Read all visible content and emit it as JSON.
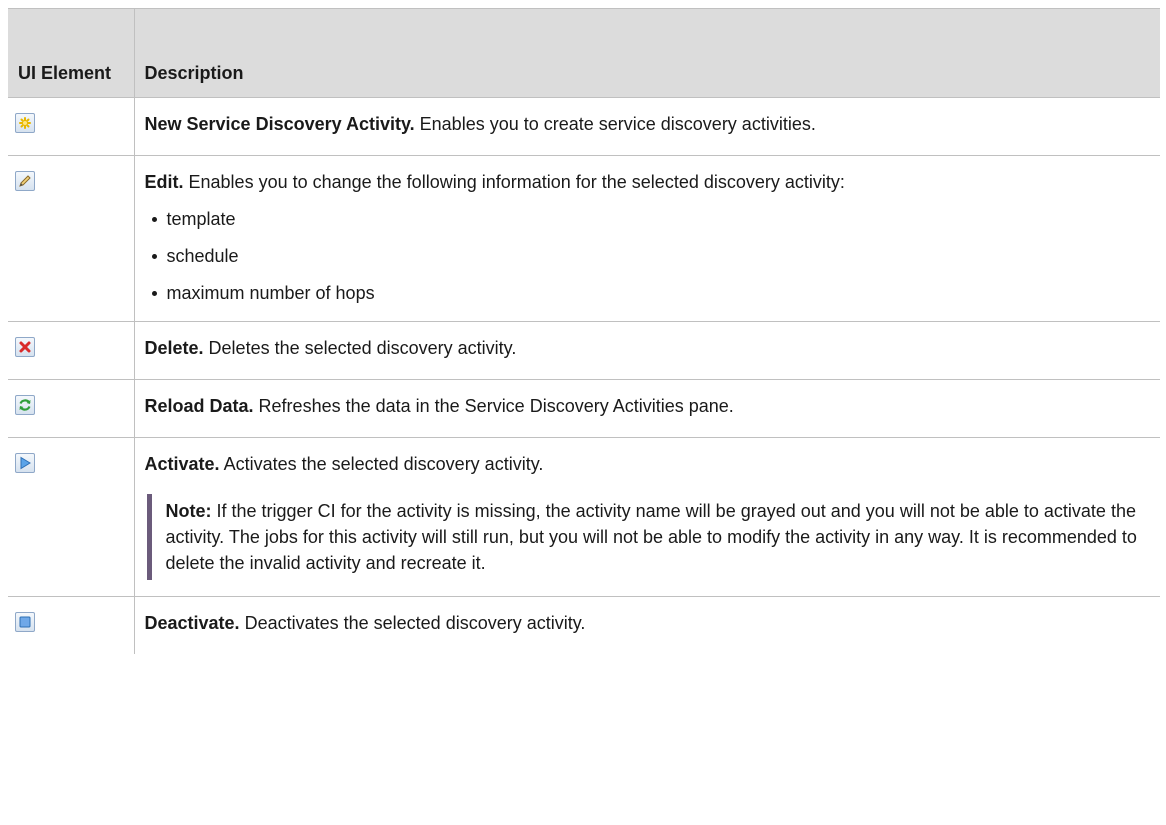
{
  "header": {
    "col_element": "UI Element",
    "col_description": "Description"
  },
  "rows": [
    {
      "icon": "new-star-icon",
      "title": "New Service Discovery Activity.",
      "text": "Enables you to create service discovery activities."
    },
    {
      "icon": "edit-pencil-icon",
      "title": "Edit.",
      "text": "Enables you to change the following information for the selected discovery activity:",
      "items": [
        "template",
        "schedule",
        "maximum number of hops"
      ]
    },
    {
      "icon": "delete-x-icon",
      "title": "Delete.",
      "text": "Deletes the selected discovery activity."
    },
    {
      "icon": "reload-icon",
      "title": "Reload Data.",
      "text": "Refreshes the data in the Service Discovery Activities pane."
    },
    {
      "icon": "activate-play-icon",
      "title": "Activate.",
      "text": "Activates the selected discovery activity.",
      "note_label": "Note:",
      "note_text": "If the trigger CI for the activity is missing, the activity name will be grayed out and you will not be able to activate the activity. The jobs for this activity will still run, but you will not be able to modify the activity in any way. It is recommended to delete the invalid activity and recreate it."
    },
    {
      "icon": "deactivate-stop-icon",
      "title": "Deactivate.",
      "text": "Deactivates the selected discovery activity."
    }
  ]
}
